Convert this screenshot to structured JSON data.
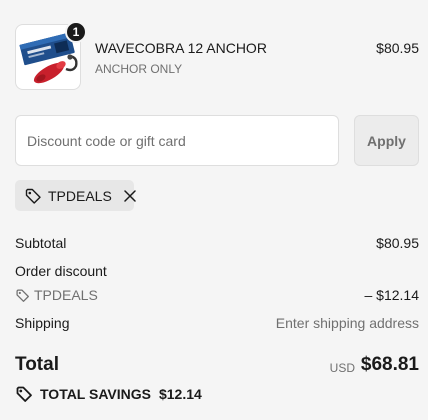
{
  "product": {
    "title": "WAVECOBRA 12 ANCHOR",
    "variant": "ANCHOR ONLY",
    "price": "$80.95",
    "quantity": "1",
    "image_icon": "product-thumbnail-icon"
  },
  "discount": {
    "placeholder": "Discount code or gift card",
    "value": "",
    "apply_label": "Apply",
    "applied_code": "TPDEALS",
    "tag_icon": "tag-icon",
    "remove_icon": "close-icon"
  },
  "summary": {
    "subtotal_label": "Subtotal",
    "subtotal_value": "$80.95",
    "order_discount_label": "Order discount",
    "discount_code": "TPDEALS",
    "discount_amount": "– $12.14",
    "shipping_label": "Shipping",
    "shipping_value": "Enter shipping address",
    "total_label": "Total",
    "total_currency": "USD",
    "total_value": "$68.81",
    "savings_label": "TOTAL SAVINGS",
    "savings_value": "$12.14"
  },
  "colors": {
    "background": "#f5f5f5",
    "text": "#1a1a1a",
    "muted": "#707070",
    "border": "#dedede",
    "product_red": "#c8202c",
    "product_box_blue": "#1f4e8c"
  }
}
